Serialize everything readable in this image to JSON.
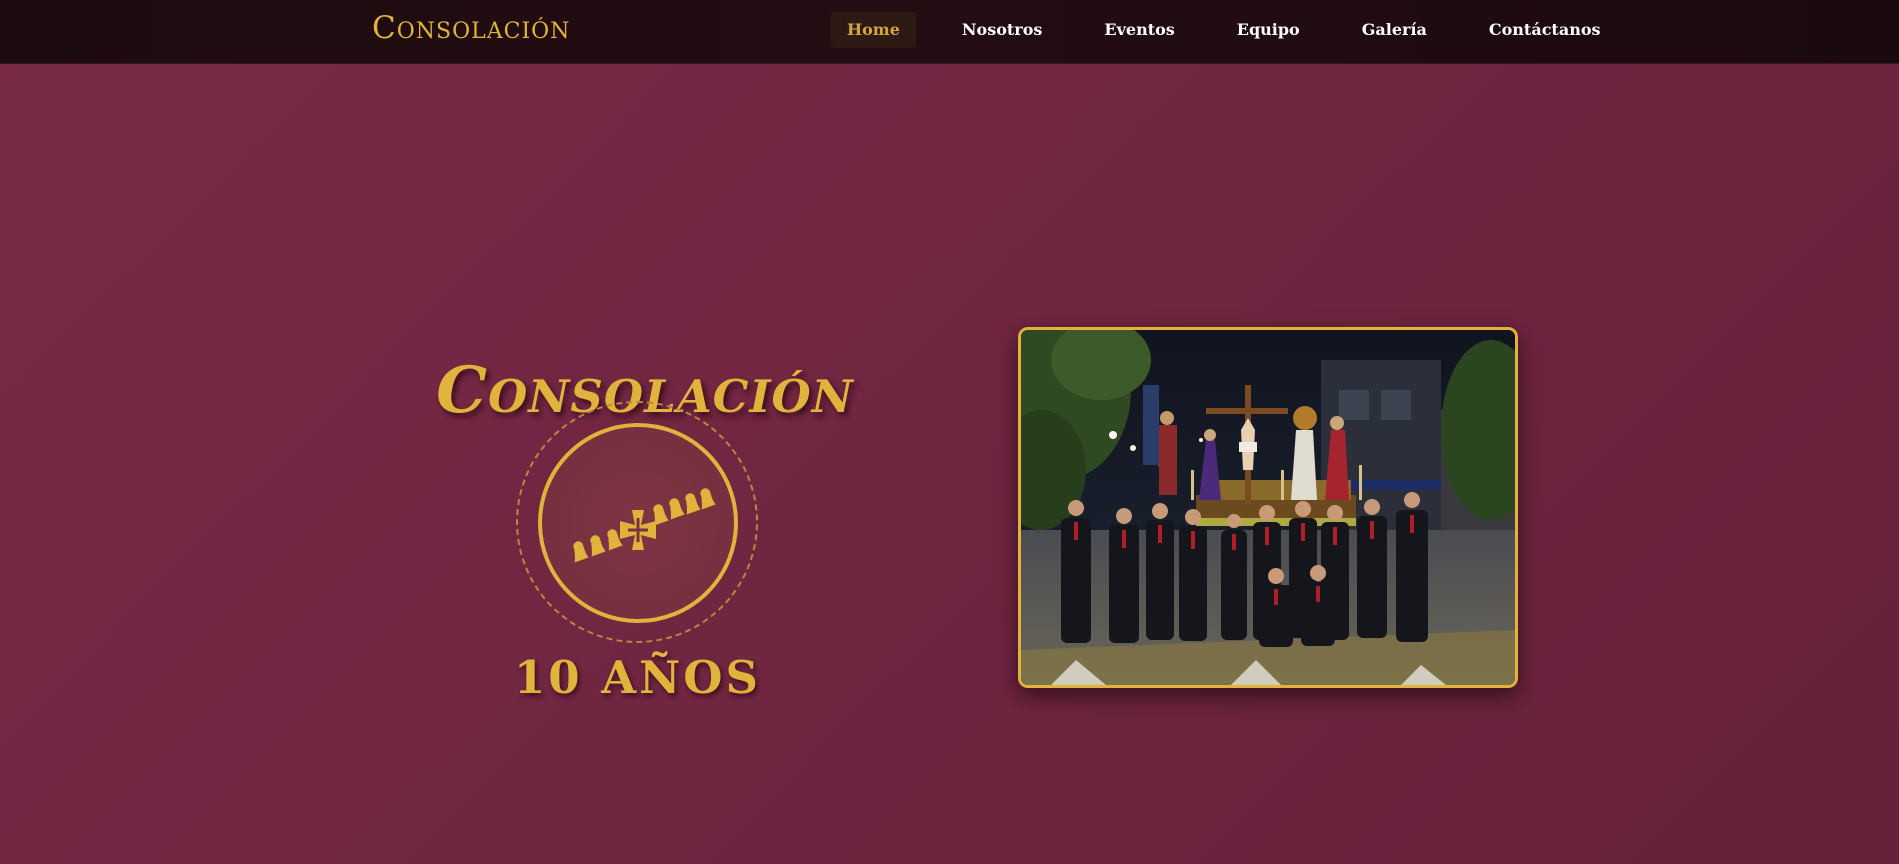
{
  "nav": {
    "brand": "Consolación",
    "links": [
      {
        "label": "Home",
        "active": true
      },
      {
        "label": "Nosotros",
        "active": false
      },
      {
        "label": "Eventos",
        "active": false
      },
      {
        "label": "Equipo",
        "active": false
      },
      {
        "label": "Galería",
        "active": false
      },
      {
        "label": "Contáctanos",
        "active": false
      }
    ]
  },
  "hero": {
    "title": "Consolación",
    "emblem_icon": "cross-procession-emblem-icon",
    "anniversary": "10 AÑOS",
    "photo_icon": "procession-group-photo"
  },
  "colors": {
    "accent_gold": "#e0b33c",
    "background_burgundy": "#702541",
    "navbar_dark": "#1c0b0f",
    "active_link_bg": "#2e1a15"
  }
}
